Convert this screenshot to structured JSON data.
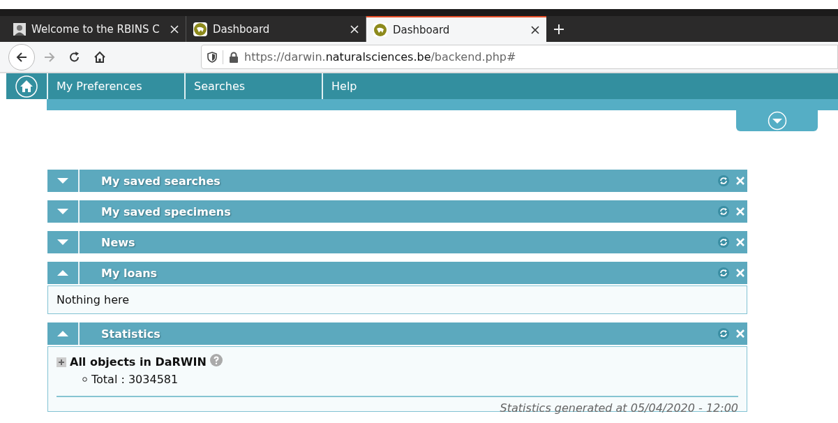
{
  "browser": {
    "tabs": [
      {
        "title": "Welcome to the RBINS C",
        "selected": false,
        "kind": "portrait"
      },
      {
        "title": "Dashboard",
        "selected": false,
        "kind": "logo"
      },
      {
        "title": "Dashboard",
        "selected": true,
        "kind": "logo"
      }
    ],
    "url": {
      "before": "https://darwin.",
      "domain": "naturalsciences.be",
      "after": "/backend.php#"
    }
  },
  "menu": {
    "items": [
      "My Preferences",
      "Searches",
      "Help"
    ]
  },
  "widgets": [
    {
      "title": "My saved searches",
      "expanded": false
    },
    {
      "title": "My saved specimens",
      "expanded": false
    },
    {
      "title": "News",
      "expanded": false
    },
    {
      "title": "My loans",
      "expanded": true,
      "body": {
        "kind": "text",
        "text": "Nothing here"
      }
    },
    {
      "title": "Statistics",
      "expanded": true,
      "body": {
        "kind": "stats",
        "heading": "All objects in DaRWIN",
        "items": [
          "Total : 3034581"
        ],
        "footer": "Statistics generated at 05/04/2020 - 12:00"
      }
    }
  ]
}
